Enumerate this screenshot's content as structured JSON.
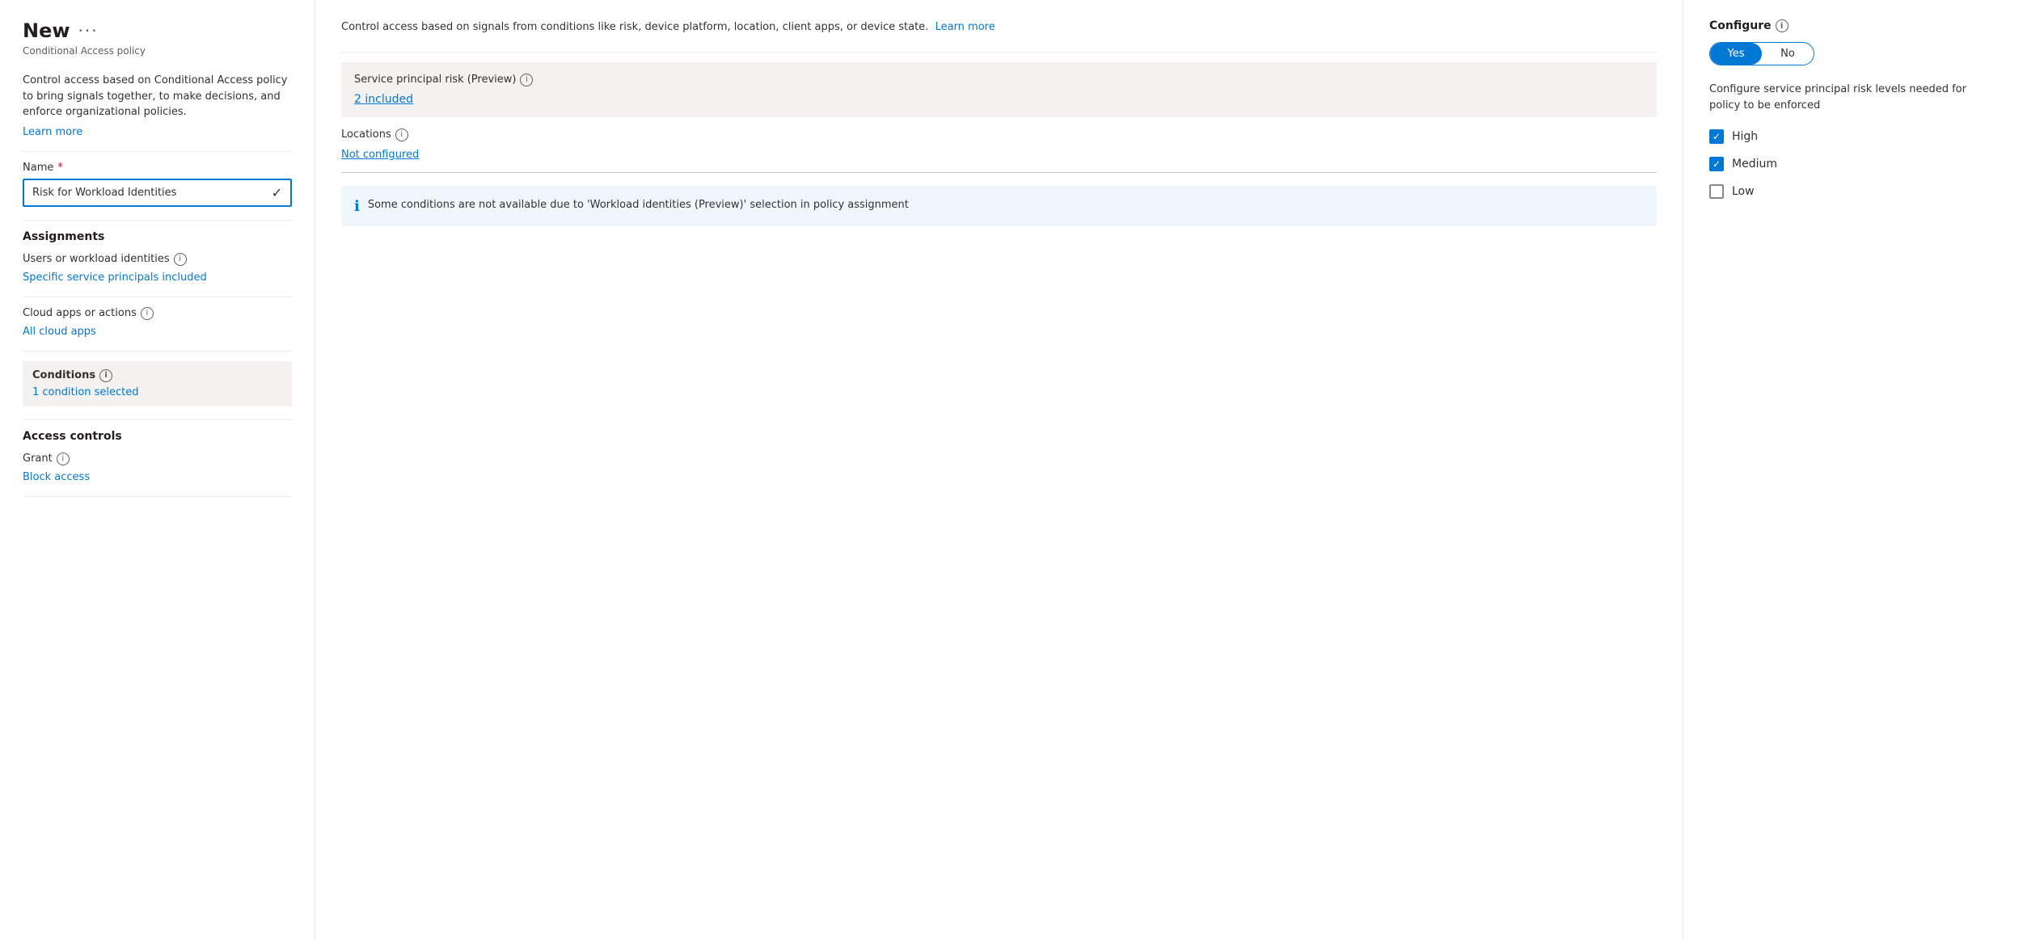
{
  "leftPanel": {
    "title": "New",
    "titleMore": "···",
    "subtitle": "Conditional Access policy",
    "description": "Control access based on Conditional Access policy to bring signals together, to make decisions, and enforce organizational policies.",
    "learnMoreLabel": "Learn more",
    "nameLabel": "Name",
    "nameRequired": "*",
    "nameValue": "Risk for Workload Identities",
    "assignmentsLabel": "Assignments",
    "usersLabel": "Users or workload identities",
    "usersValue": "Specific service principals included",
    "cloudAppsLabel": "Cloud apps or actions",
    "cloudAppsValue": "All cloud apps",
    "conditionsLabel": "Conditions",
    "conditionsValue": "1 condition selected",
    "accessControlsLabel": "Access controls",
    "grantLabel": "Grant",
    "grantValue": "Block access"
  },
  "middlePanel": {
    "description": "Control access based on signals from conditions like risk, device platform, location, client apps, or device state.",
    "learnMoreLabel": "Learn more",
    "servicePrincipalLabel": "Service principal risk (Preview)",
    "servicePrincipalValue": "2 included",
    "locationsLabel": "Locations",
    "locationsValue": "Not configured",
    "infoBoxText": "Some conditions are not available due to 'Workload identities (Preview)' selection in policy assignment"
  },
  "rightPanel": {
    "title": "Configure service principal risk levels needed for policy to be enforced",
    "configureLabel": "Configure",
    "yesLabel": "Yes",
    "noLabel": "No",
    "configureDescription": "Configure service principal risk levels needed for policy to be enforced",
    "highLabel": "High",
    "highChecked": true,
    "mediumLabel": "Medium",
    "mediumChecked": true,
    "lowLabel": "Low",
    "lowChecked": false
  },
  "icons": {
    "info": "ⓘ",
    "checkmark": "✓",
    "infoFilled": "ℹ"
  }
}
